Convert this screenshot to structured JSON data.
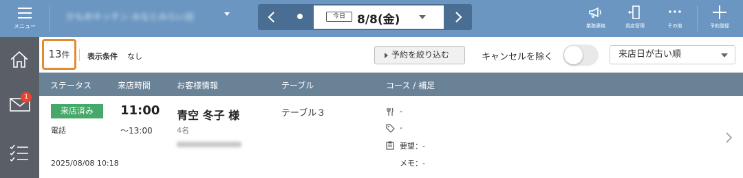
{
  "topbar": {
    "menu_label": "メニュー",
    "store_name": "かもめキッチン みなとみらい店",
    "date_nav": {
      "today_label": "今日",
      "date": "8/8(金)"
    },
    "tools": [
      {
        "label": "業務連絡",
        "icon": "megaphone-icon"
      },
      {
        "label": "退店管理",
        "icon": "door-exit-icon"
      },
      {
        "label": "その他",
        "icon": "more-dots-icon"
      },
      {
        "label": "予約登録",
        "icon": "plus-icon"
      }
    ]
  },
  "sidebar": {
    "items": [
      {
        "icon": "home-icon"
      },
      {
        "icon": "mail-icon",
        "badge": "1"
      },
      {
        "icon": "checklist-icon"
      }
    ]
  },
  "filter": {
    "count": "13",
    "count_unit": "件",
    "condition_label": "表示条件",
    "condition_value": "なし",
    "narrow_button": "予約を絞り込む",
    "exclude_cancel_label": "キャンセルを除く",
    "exclude_cancel_on": false,
    "sort_selected": "来店日が古い順"
  },
  "table": {
    "headers": [
      "ステータス",
      "来店時間",
      "お客様情報",
      "テーブル",
      "コース / 補足"
    ],
    "rows": [
      {
        "status": "来店済み",
        "status_color": "#46a86a",
        "channel": "電話",
        "created": "2025/08/08 10:18",
        "time_start": "11:00",
        "time_end": "～13:00",
        "customer_name": "青空 冬子 様",
        "guests": "4名",
        "table": "テーブル３",
        "course": "-",
        "tag": "-",
        "request": "要望：-",
        "memo": "メモ：-"
      }
    ]
  },
  "colors": {
    "topbar": "#6a96c1",
    "date_nav": "#496d93",
    "sidebar": "#5a5e66",
    "table_header": "#6a8296",
    "highlight": "#e48a2e",
    "badge": "#e64230"
  }
}
